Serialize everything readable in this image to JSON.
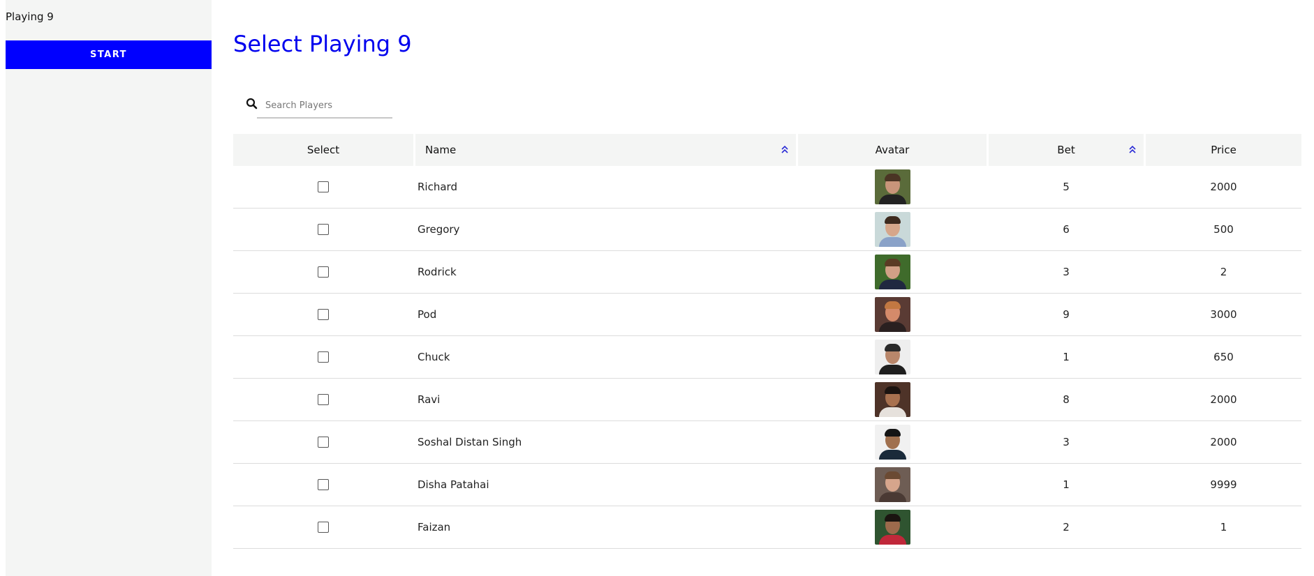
{
  "sidebar": {
    "title": "Playing 9",
    "start_label": "START"
  },
  "main": {
    "title": "Select Playing 9",
    "search": {
      "placeholder": "Search Players",
      "icon": "search-icon"
    }
  },
  "table": {
    "headers": {
      "select": "Select",
      "name": "Name",
      "avatar": "Avatar",
      "bet": "Bet",
      "price": "Price"
    },
    "rows": [
      {
        "name": "Richard",
        "bet": "5",
        "price": "2000",
        "avatar": {
          "bg": "#5a6b3a",
          "skin": "#c8957a",
          "hair": "#4a3424",
          "shirt": "#222222"
        }
      },
      {
        "name": "Gregory",
        "bet": "6",
        "price": "500",
        "avatar": {
          "bg": "#c9d9d9",
          "skin": "#d6a68a",
          "hair": "#3d2a1e",
          "shirt": "#8aa2c8"
        }
      },
      {
        "name": "Rodrick",
        "bet": "3",
        "price": "2",
        "avatar": {
          "bg": "#3f6b2b",
          "skin": "#d1a086",
          "hair": "#5a3b24",
          "shirt": "#202840"
        }
      },
      {
        "name": "Pod",
        "bet": "9",
        "price": "3000",
        "avatar": {
          "bg": "#5a3b34",
          "skin": "#d48a6a",
          "hair": "#c27842",
          "shirt": "#2a2020"
        }
      },
      {
        "name": "Chuck",
        "bet": "1",
        "price": "650",
        "avatar": {
          "bg": "#eeeeee",
          "skin": "#b9876b",
          "hair": "#2b2b2b",
          "shirt": "#1f1f1f"
        }
      },
      {
        "name": "Ravi",
        "bet": "8",
        "price": "2000",
        "avatar": {
          "bg": "#4e3328",
          "skin": "#a8714f",
          "hair": "#1c1410",
          "shirt": "#e6e1dc"
        }
      },
      {
        "name": "Soshal Distan Singh",
        "bet": "3",
        "price": "2000",
        "avatar": {
          "bg": "#f1f1f1",
          "skin": "#a0704e",
          "hair": "#151515",
          "shirt": "#1a2a3a"
        }
      },
      {
        "name": "Disha Patahai",
        "bet": "1",
        "price": "9999",
        "avatar": {
          "bg": "#6e5d54",
          "skin": "#d6a58c",
          "hair": "#6b4a33",
          "shirt": "#4a3a34"
        }
      },
      {
        "name": "Faizan",
        "bet": "2",
        "price": "1",
        "avatar": {
          "bg": "#2f5430",
          "skin": "#9d6a4c",
          "hair": "#1a1410",
          "shirt": "#c0283a"
        }
      }
    ]
  },
  "colors": {
    "accent": "#0000ff",
    "title": "#0000ee",
    "header_bg": "#f4f5f4",
    "row_border": "#dcdcdc"
  }
}
